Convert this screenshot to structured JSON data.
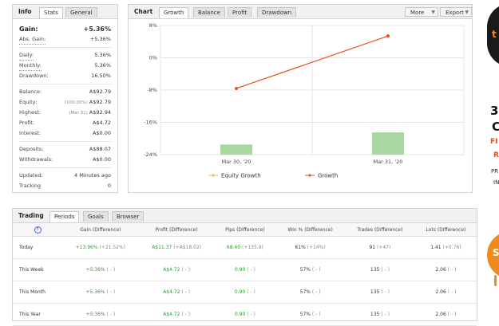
{
  "info_panel": {
    "title": "Info",
    "tabs": [
      "Stats",
      "General"
    ],
    "gain": {
      "label": "Gain:",
      "value": "+5.36%"
    },
    "abs_gain": {
      "label": "Abs. Gain:",
      "value": "+5.36%"
    },
    "daily": {
      "label": "Daily:",
      "value": "5.36%"
    },
    "monthly": {
      "label": "Monthly:",
      "value": "5.36%"
    },
    "drawdown": {
      "label": "Drawdown:",
      "value": "16.50%"
    },
    "balance": {
      "label": "Balance:",
      "value": "A$92.79"
    },
    "equity": {
      "label": "Equity:",
      "note": "(100.00%)",
      "value": "A$92.79"
    },
    "highest": {
      "label": "Highest:",
      "note": "(Mar 31)",
      "value": "A$92.94"
    },
    "profit": {
      "label": "Profit:",
      "value": "A$4.72"
    },
    "interest": {
      "label": "Interest:",
      "value": "A$0.00"
    },
    "deposits": {
      "label": "Deposits:",
      "value": "A$88.07"
    },
    "withdrawals": {
      "label": "Withdrawals:",
      "value": "A$0.00"
    },
    "updated": {
      "label": "Updated:",
      "value": "4 Minutes ago"
    },
    "tracking": {
      "label": "Tracking",
      "value": "0"
    }
  },
  "chart_panel": {
    "title": "Chart",
    "tabs": [
      "Growth",
      "Balance",
      "Profit",
      "Drawdown"
    ],
    "more_label": "More",
    "export_label": "Export"
  },
  "chart_data": {
    "type": "line",
    "categories": [
      "Mar 30, '20",
      "Mar 31, '20"
    ],
    "ylim": [
      -24,
      8
    ],
    "yticks": [
      "8%",
      "0%",
      "-8%",
      "-16%",
      "-24%"
    ],
    "ytick_values": [
      8,
      0,
      -8,
      -16,
      -24
    ],
    "grid": true,
    "legend_position": "bottom",
    "series": [
      {
        "name": "Equity Growth",
        "type": "bar",
        "color": "#a8d8a0",
        "values": [
          -21.5,
          -18.5
        ]
      },
      {
        "name": "Growth",
        "type": "line",
        "color": "#e3531f",
        "values": [
          -7.6,
          5.4
        ]
      }
    ],
    "legend_colors": {
      "equity_growth": "#e8c53a",
      "growth": "#e3531f"
    }
  },
  "trading_panel": {
    "title": "Trading",
    "tabs": [
      "Periods",
      "Goals",
      "Browser"
    ],
    "help_icon": "?",
    "columns": [
      "Gain (Difference)",
      "Profit (Difference)",
      "Pips (Difference)",
      "Win % (Difference)",
      "Trades (Difference)",
      "Lots (Difference)"
    ],
    "rows": [
      {
        "period": "Today",
        "gain": "+13.96%",
        "gain_d": "(+21.52%)",
        "profit": "A$11.37",
        "profit_d": "(+A$18.02)",
        "pips": "68.40",
        "pips_d": "(+135.9)",
        "win": "61%",
        "win_d": "(+14%)",
        "trades": "91",
        "trades_d": "(+47)",
        "lots": "1.41",
        "lots_d": "(+0.76)"
      },
      {
        "period": "This Week",
        "gain": "+5.36%",
        "gain_d": "( - )",
        "profit": "A$4.72",
        "profit_d": "( - )",
        "pips": "0.90",
        "pips_d": "( - )",
        "win": "57%",
        "win_d": "( - )",
        "trades": "135",
        "trades_d": "( - )",
        "lots": "2.06",
        "lots_d": "( - )"
      },
      {
        "period": "This Month",
        "gain": "+5.36%",
        "gain_d": "( - )",
        "profit": "A$4.72",
        "profit_d": "( - )",
        "pips": "0.90",
        "pips_d": "( - )",
        "win": "57%",
        "win_d": "( - )",
        "trades": "135",
        "trades_d": "( - )",
        "lots": "2.06",
        "lots_d": "( - )"
      },
      {
        "period": "This Year",
        "gain": "+5.36%",
        "gain_d": "( - )",
        "profit": "A$4.72",
        "profit_d": "( - )",
        "pips": "0.90",
        "pips_d": "( - )",
        "win": "57%",
        "win_d": "( - )",
        "trades": "135",
        "trades_d": "( - )",
        "lots": "2.06",
        "lots_d": "( - )"
      }
    ]
  },
  "ad_fragment": {
    "lines": [
      "t",
      "3",
      "C",
      "FI",
      "R",
      "PR",
      "IN",
      "S"
    ],
    "colors": {
      "dark": "#1a1a1a",
      "orange": "#f08a1c",
      "red": "#e8491d"
    }
  }
}
